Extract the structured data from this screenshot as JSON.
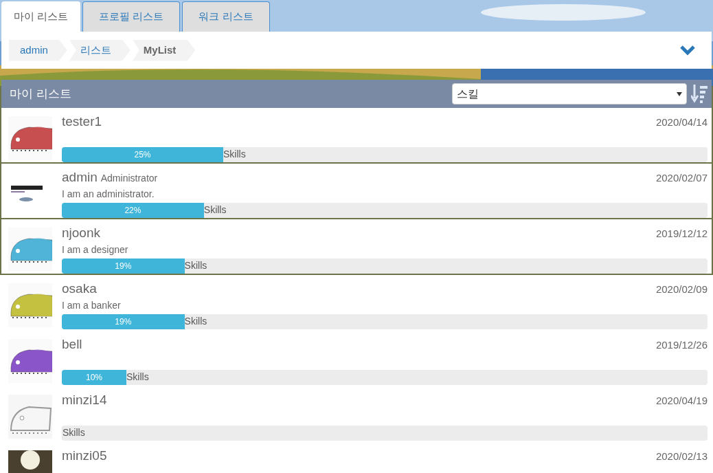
{
  "tabs": [
    {
      "label": "마이 리스트",
      "selected": true
    },
    {
      "label": "프로필 리스트",
      "selected": false
    },
    {
      "label": "워크 리스트",
      "selected": false
    }
  ],
  "breadcrumb": [
    {
      "label": "admin",
      "current": false
    },
    {
      "label": "리스트",
      "current": false
    },
    {
      "label": "MyList",
      "current": true
    }
  ],
  "list_header": {
    "title": "마이 리스트",
    "sort_select": {
      "value": "스킬"
    }
  },
  "users": [
    {
      "name": "tester1",
      "avatar": {
        "kind": "bug",
        "color": "#c84f4f"
      },
      "date": "2020/04/14",
      "progress": {
        "level": 0.25,
        "percent": "25%",
        "label": "Skills"
      }
    },
    {
      "name": "admin",
      "role": "Administrator",
      "description": "I am an administrator.",
      "avatar": {
        "kind": "logo"
      },
      "date": "2020/02/07",
      "progress": {
        "level": 0.22,
        "percent": "22%",
        "label": "Skills"
      }
    },
    {
      "name": "njoonk",
      "description": "I am a designer",
      "avatar": {
        "kind": "bug",
        "color": "#4fb4d8"
      },
      "date": "2019/12/12",
      "progress": {
        "level": 0.19,
        "percent": "19%",
        "label": "Skills"
      }
    },
    {
      "name": "osaka",
      "description": "I am a banker",
      "avatar": {
        "kind": "bug",
        "color": "#c4c040"
      },
      "date": "2020/02/09",
      "progress": {
        "level": 0.19,
        "percent": "19%",
        "label": "Skills"
      }
    },
    {
      "name": "bell",
      "avatar": {
        "kind": "bug",
        "color": "#8a55c8"
      },
      "date": "2019/12/26",
      "progress": {
        "level": 0.1,
        "percent": "10%",
        "label": "Skills"
      }
    },
    {
      "name": "minzi14",
      "avatar": {
        "kind": "sketch"
      },
      "date": "2020/04/19",
      "progress": {
        "level": 0,
        "label": "Skills"
      }
    },
    {
      "name": "minzi05",
      "date": "2020/02/13"
    }
  ]
}
